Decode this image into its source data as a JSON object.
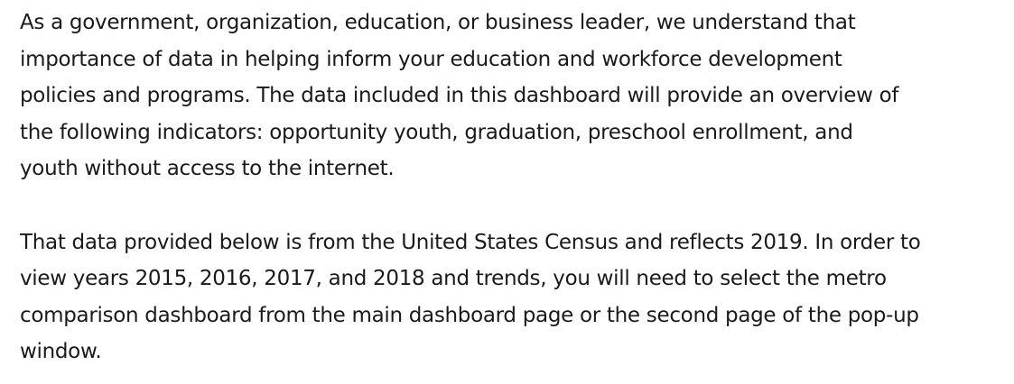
{
  "document": {
    "paragraphs": [
      {
        "lines": [
          "As a government, organization, education, or business leader, we understand that",
          "importance of data in helping inform your education and workforce development",
          "policies and programs. The data included in this dashboard will provide an overview of",
          "the following indicators: opportunity youth, graduation, preschool enrollment, and",
          "youth without access to the internet."
        ]
      },
      {
        "lines": [
          "That data provided below is from the United States Census and reflects 2019. In order to",
          "view years 2015, 2016, 2017, and 2018 and trends, you will need to select the metro",
          "comparison dashboard from the main dashboard page or the second page of the pop-up",
          "window."
        ]
      }
    ]
  }
}
